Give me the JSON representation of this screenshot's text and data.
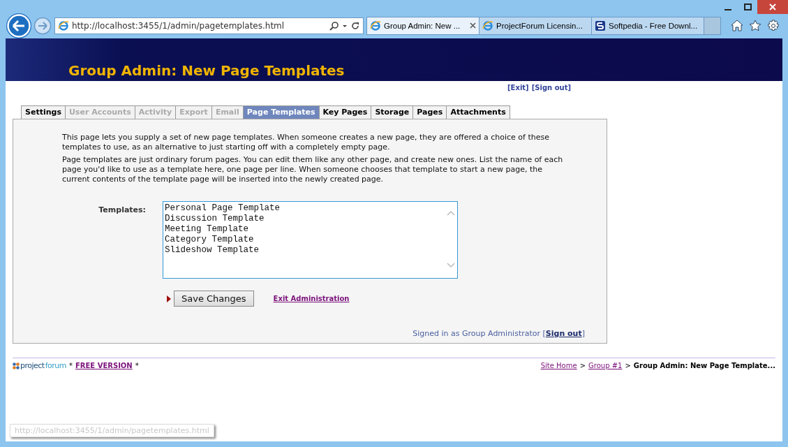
{
  "browser": {
    "address": "http://localhost:3455/1/admin/pagetemplates.html",
    "tabs": [
      {
        "title": "Group Admin: New ...",
        "selected": true,
        "kind": "ie"
      },
      {
        "title": "ProjectForum Licensin...",
        "selected": false,
        "kind": "ie"
      },
      {
        "title": "Softpedia - Free Downl...",
        "selected": false,
        "kind": "site"
      }
    ],
    "status_url": "http://localhost:3455/1/admin/pagetemplates.html"
  },
  "page": {
    "title": "Group Admin: New Page Templates",
    "top_links": [
      {
        "label": "[Exit]"
      },
      {
        "label": "[Sign out]"
      }
    ],
    "tabs": [
      {
        "label": "Settings",
        "selected": false,
        "disabled": false
      },
      {
        "label": "User Accounts",
        "selected": false,
        "disabled": true
      },
      {
        "label": "Activity",
        "selected": false,
        "disabled": true
      },
      {
        "label": "Export",
        "selected": false,
        "disabled": true
      },
      {
        "label": "Email",
        "selected": false,
        "disabled": true
      },
      {
        "label": "Page Templates",
        "selected": true,
        "disabled": false
      },
      {
        "label": "Key Pages",
        "selected": false,
        "disabled": false
      },
      {
        "label": "Storage",
        "selected": false,
        "disabled": false
      },
      {
        "label": "Pages",
        "selected": false,
        "disabled": false
      },
      {
        "label": "Attachments",
        "selected": false,
        "disabled": false
      }
    ],
    "paragraphs": [
      "This page lets you supply a set of new page templates. When someone creates a new page, they are offered a choice of these templates to use, as an alternative to just starting off with a completely empty page.",
      "Page templates are just ordinary forum pages. You can edit them like any other page, and create new ones. List the name of each page you'd like to use as a template here, one page per line. When someone chooses that template to start a new page, the current contents of the template page will be inserted into the newly created page."
    ],
    "templates": {
      "label": "Templates:",
      "value": [
        "Personal Page Template",
        "Discussion Template",
        "Meeting Template",
        "Category Template",
        "Slideshow Template"
      ]
    },
    "save_button": "Save Changes",
    "exit_link": "Exit Administration",
    "signed_in": {
      "text": "Signed in as Group Administrator [",
      "link": "Sign out",
      "close": "]"
    },
    "footer": {
      "logo_a": "project",
      "logo_b": "forum",
      "star": "*",
      "version": "FREE VERSION",
      "star2": "*",
      "breadcrumbs": [
        {
          "label": "Site Home",
          "link": true
        },
        {
          "label": ">",
          "link": false
        },
        {
          "label": "Group #1",
          "link": true
        },
        {
          "label": ">",
          "link": false
        },
        {
          "label": "Group Admin: New Page Template...",
          "link": false
        }
      ]
    }
  }
}
